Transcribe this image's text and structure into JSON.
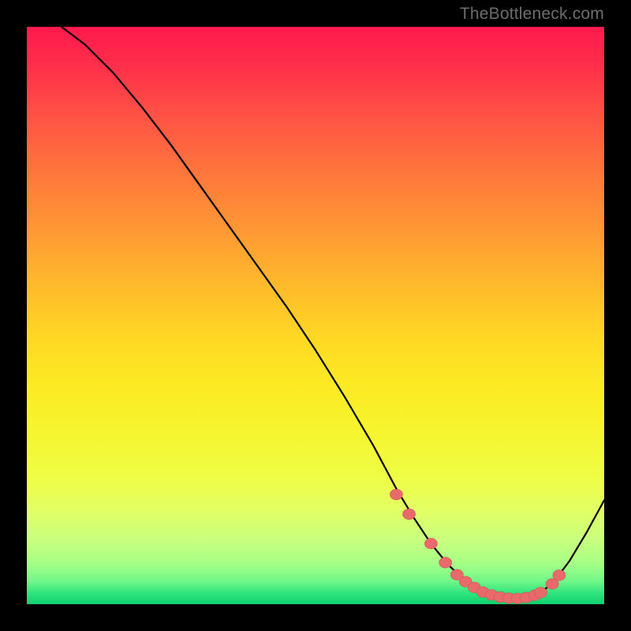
{
  "source_watermark": "TheBottleneck.com",
  "colors": {
    "background": "#000000",
    "dot_fill": "#e86a6a",
    "dot_stroke": "#cf5555",
    "curve": "#000000"
  },
  "chart_data": {
    "type": "line",
    "title": "",
    "xlabel": "",
    "ylabel": "",
    "xlim": [
      0,
      100
    ],
    "ylim": [
      0,
      100
    ],
    "grid": false,
    "legend": false,
    "series": [
      {
        "name": "curve",
        "x": [
          6,
          10,
          15,
          20,
          25,
          30,
          35,
          40,
          45,
          50,
          55,
          60,
          64,
          67,
          70,
          73,
          76,
          79,
          82,
          85,
          88,
          91,
          94,
          97,
          100
        ],
        "y": [
          100,
          97,
          92,
          86,
          79.5,
          72.5,
          65.5,
          58.5,
          51.5,
          44,
          36,
          27.5,
          20,
          15,
          10.5,
          6.8,
          4,
          2.2,
          1.2,
          1.0,
          1.4,
          3.5,
          7.5,
          12.5,
          18
        ]
      }
    ],
    "markers": [
      {
        "x": 64.0,
        "y": 19.0
      },
      {
        "x": 66.2,
        "y": 15.6
      },
      {
        "x": 70.0,
        "y": 10.5
      },
      {
        "x": 72.5,
        "y": 7.2
      },
      {
        "x": 74.5,
        "y": 5.1
      },
      {
        "x": 76.0,
        "y": 3.9
      },
      {
        "x": 77.5,
        "y": 2.9
      },
      {
        "x": 79.0,
        "y": 2.1
      },
      {
        "x": 80.5,
        "y": 1.6
      },
      {
        "x": 82.0,
        "y": 1.25
      },
      {
        "x": 83.5,
        "y": 1.05
      },
      {
        "x": 85.0,
        "y": 1.0
      },
      {
        "x": 86.5,
        "y": 1.15
      },
      {
        "x": 88.0,
        "y": 1.55
      },
      {
        "x": 89.0,
        "y": 2.0
      },
      {
        "x": 91.0,
        "y": 3.5
      },
      {
        "x": 92.2,
        "y": 5.0
      }
    ],
    "marker_radius": 8
  }
}
